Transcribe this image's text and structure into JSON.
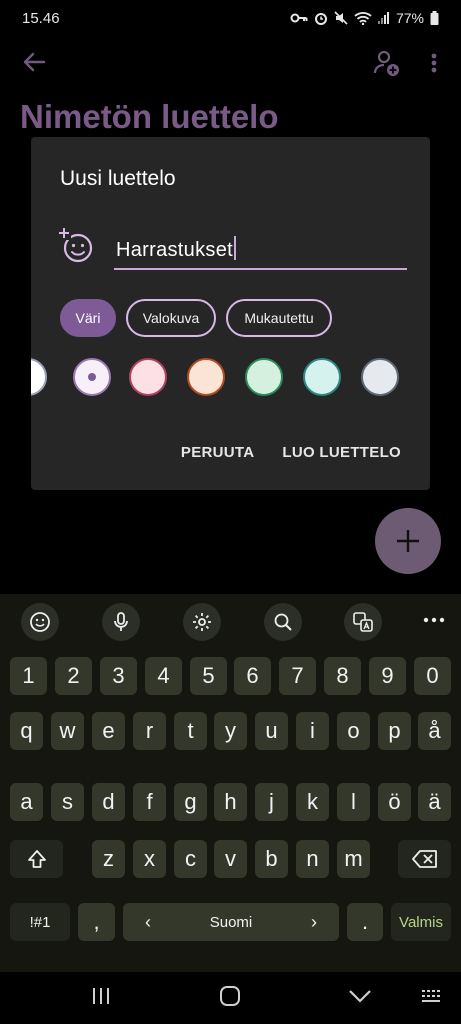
{
  "status": {
    "time": "15.46",
    "battery": "77%"
  },
  "appbar": {
    "background_title": "Nimetön luettelo"
  },
  "dialog": {
    "title": "Uusi luettelo",
    "name_value": "Harrastukset",
    "chips": [
      {
        "label": "Väri",
        "selected": true
      },
      {
        "label": "Valokuva",
        "selected": false
      },
      {
        "label": "Mukautettu",
        "selected": false
      }
    ],
    "swatches": [
      {
        "fill": "#ffffff",
        "border": "#9ca0b6"
      },
      {
        "fill": "#f7f0f8",
        "border": "#9a7ab3",
        "selected": true
      },
      {
        "fill": "#fde0e6",
        "border": "#b0405c"
      },
      {
        "fill": "#fbe3d6",
        "border": "#b14d22"
      },
      {
        "fill": "#d6f0e0",
        "border": "#2a8a5a"
      },
      {
        "fill": "#d5f2ee",
        "border": "#2a8a80"
      },
      {
        "fill": "#e6eaee",
        "border": "#5f6a76"
      }
    ],
    "cancel_label": "PERUUTA",
    "create_label": "LUO LUETTELO"
  },
  "keyboard": {
    "row_numbers": [
      "1",
      "2",
      "3",
      "4",
      "5",
      "6",
      "7",
      "8",
      "9",
      "0"
    ],
    "row_q": [
      "q",
      "w",
      "e",
      "r",
      "t",
      "y",
      "u",
      "i",
      "o",
      "p",
      "å"
    ],
    "row_a": [
      "a",
      "s",
      "d",
      "f",
      "g",
      "h",
      "j",
      "k",
      "l",
      "ö",
      "ä"
    ],
    "row_z": [
      "z",
      "x",
      "c",
      "v",
      "b",
      "n",
      "m"
    ],
    "symbols_label": "!#1",
    "comma_label": ",",
    "space_label": "Suomi",
    "period_label": ".",
    "done_label": "Valmis"
  },
  "colors": {
    "accent": "#7e5b96",
    "dialog_bg": "#262626",
    "key_bg": "#33382a",
    "done": "#b7d48b"
  }
}
